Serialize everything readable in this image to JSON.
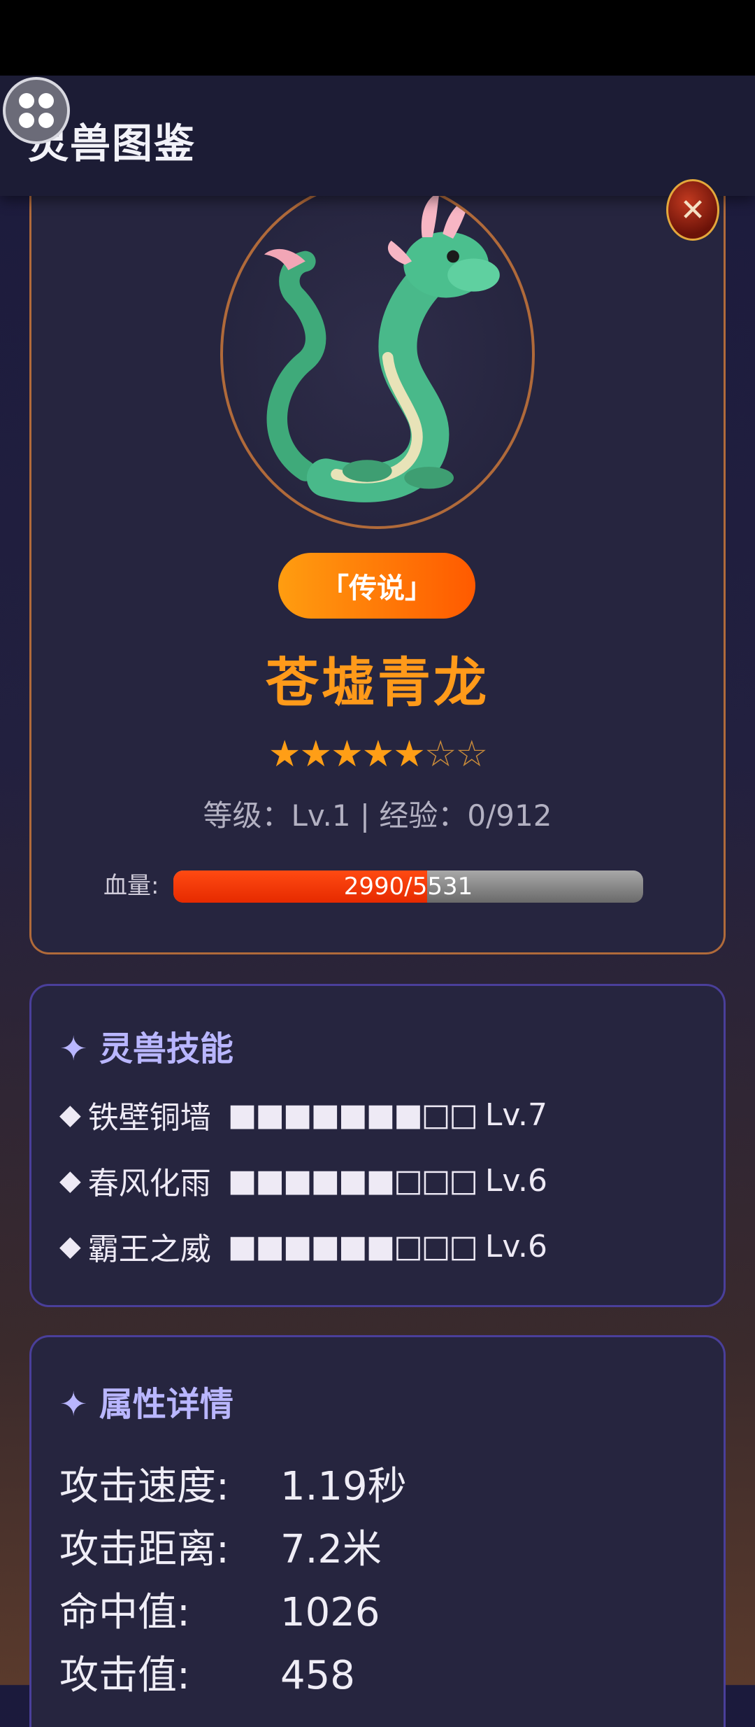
{
  "header": {
    "title": "灵兽图鉴",
    "close_icon": "close-x-icon",
    "menu_icon": "four-dot-menu-icon"
  },
  "beast": {
    "image_icon": "green-dragon-portrait",
    "rarity": "「传说」",
    "name": "苍墟青龙",
    "stars": {
      "filled": "★★★★★",
      "empty": "☆☆",
      "value": 5,
      "max": 7
    },
    "level_line": "等级：Lv.1 | 经验：0/912",
    "hp": {
      "label": "血量:",
      "current": 2990,
      "max": 5531,
      "text": "2990/5531"
    }
  },
  "skills": {
    "title": "✦ 灵兽技能",
    "items": [
      {
        "name": "铁壁铜墙",
        "bar": "■■■■■■■□□",
        "level_value": 7,
        "level": "Lv.7"
      },
      {
        "name": "春风化雨",
        "bar": "■■■■■■□□□",
        "level_value": 6,
        "level": "Lv.6"
      },
      {
        "name": "霸王之威",
        "bar": "■■■■■■□□□",
        "level_value": 6,
        "level": "Lv.6"
      }
    ]
  },
  "attributes": {
    "title": "✦ 属性详情",
    "items": [
      {
        "label": "攻击速度:",
        "value": "1.19秒"
      },
      {
        "label": "攻击距离:",
        "value": "7.2米"
      },
      {
        "label": "命中值:",
        "value": "1026"
      },
      {
        "label": "攻击值:",
        "value": "458"
      }
    ]
  },
  "colors": {
    "accent": "#ff9a1a",
    "hp": "#ff3a00",
    "panel_border": "#4a3f9a",
    "card_border": "#b06a3a"
  }
}
